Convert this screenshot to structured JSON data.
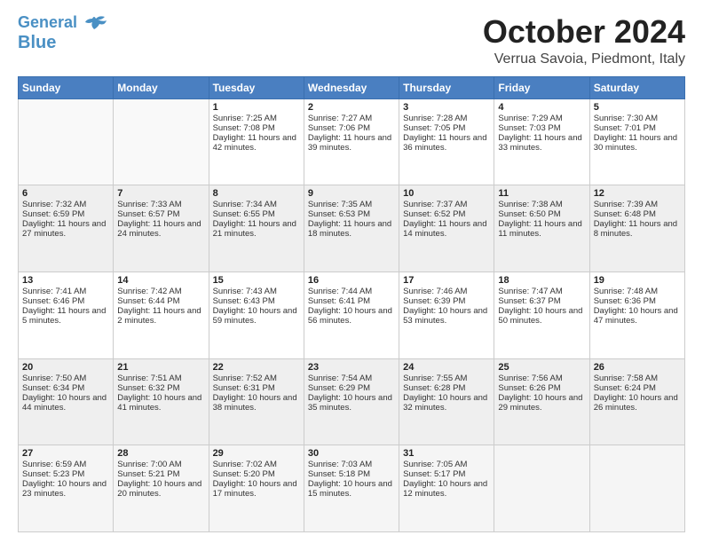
{
  "header": {
    "logo_line1": "General",
    "logo_line2": "Blue",
    "title": "October 2024",
    "subtitle": "Verrua Savoia, Piedmont, Italy"
  },
  "days_of_week": [
    "Sunday",
    "Monday",
    "Tuesday",
    "Wednesday",
    "Thursday",
    "Friday",
    "Saturday"
  ],
  "weeks": [
    [
      {
        "day": "",
        "info": ""
      },
      {
        "day": "",
        "info": ""
      },
      {
        "day": "1",
        "sunrise": "Sunrise: 7:25 AM",
        "sunset": "Sunset: 7:08 PM",
        "daylight": "Daylight: 11 hours and 42 minutes."
      },
      {
        "day": "2",
        "sunrise": "Sunrise: 7:27 AM",
        "sunset": "Sunset: 7:06 PM",
        "daylight": "Daylight: 11 hours and 39 minutes."
      },
      {
        "day": "3",
        "sunrise": "Sunrise: 7:28 AM",
        "sunset": "Sunset: 7:05 PM",
        "daylight": "Daylight: 11 hours and 36 minutes."
      },
      {
        "day": "4",
        "sunrise": "Sunrise: 7:29 AM",
        "sunset": "Sunset: 7:03 PM",
        "daylight": "Daylight: 11 hours and 33 minutes."
      },
      {
        "day": "5",
        "sunrise": "Sunrise: 7:30 AM",
        "sunset": "Sunset: 7:01 PM",
        "daylight": "Daylight: 11 hours and 30 minutes."
      }
    ],
    [
      {
        "day": "6",
        "sunrise": "Sunrise: 7:32 AM",
        "sunset": "Sunset: 6:59 PM",
        "daylight": "Daylight: 11 hours and 27 minutes."
      },
      {
        "day": "7",
        "sunrise": "Sunrise: 7:33 AM",
        "sunset": "Sunset: 6:57 PM",
        "daylight": "Daylight: 11 hours and 24 minutes."
      },
      {
        "day": "8",
        "sunrise": "Sunrise: 7:34 AM",
        "sunset": "Sunset: 6:55 PM",
        "daylight": "Daylight: 11 hours and 21 minutes."
      },
      {
        "day": "9",
        "sunrise": "Sunrise: 7:35 AM",
        "sunset": "Sunset: 6:53 PM",
        "daylight": "Daylight: 11 hours and 18 minutes."
      },
      {
        "day": "10",
        "sunrise": "Sunrise: 7:37 AM",
        "sunset": "Sunset: 6:52 PM",
        "daylight": "Daylight: 11 hours and 14 minutes."
      },
      {
        "day": "11",
        "sunrise": "Sunrise: 7:38 AM",
        "sunset": "Sunset: 6:50 PM",
        "daylight": "Daylight: 11 hours and 11 minutes."
      },
      {
        "day": "12",
        "sunrise": "Sunrise: 7:39 AM",
        "sunset": "Sunset: 6:48 PM",
        "daylight": "Daylight: 11 hours and 8 minutes."
      }
    ],
    [
      {
        "day": "13",
        "sunrise": "Sunrise: 7:41 AM",
        "sunset": "Sunset: 6:46 PM",
        "daylight": "Daylight: 11 hours and 5 minutes."
      },
      {
        "day": "14",
        "sunrise": "Sunrise: 7:42 AM",
        "sunset": "Sunset: 6:44 PM",
        "daylight": "Daylight: 11 hours and 2 minutes."
      },
      {
        "day": "15",
        "sunrise": "Sunrise: 7:43 AM",
        "sunset": "Sunset: 6:43 PM",
        "daylight": "Daylight: 10 hours and 59 minutes."
      },
      {
        "day": "16",
        "sunrise": "Sunrise: 7:44 AM",
        "sunset": "Sunset: 6:41 PM",
        "daylight": "Daylight: 10 hours and 56 minutes."
      },
      {
        "day": "17",
        "sunrise": "Sunrise: 7:46 AM",
        "sunset": "Sunset: 6:39 PM",
        "daylight": "Daylight: 10 hours and 53 minutes."
      },
      {
        "day": "18",
        "sunrise": "Sunrise: 7:47 AM",
        "sunset": "Sunset: 6:37 PM",
        "daylight": "Daylight: 10 hours and 50 minutes."
      },
      {
        "day": "19",
        "sunrise": "Sunrise: 7:48 AM",
        "sunset": "Sunset: 6:36 PM",
        "daylight": "Daylight: 10 hours and 47 minutes."
      }
    ],
    [
      {
        "day": "20",
        "sunrise": "Sunrise: 7:50 AM",
        "sunset": "Sunset: 6:34 PM",
        "daylight": "Daylight: 10 hours and 44 minutes."
      },
      {
        "day": "21",
        "sunrise": "Sunrise: 7:51 AM",
        "sunset": "Sunset: 6:32 PM",
        "daylight": "Daylight: 10 hours and 41 minutes."
      },
      {
        "day": "22",
        "sunrise": "Sunrise: 7:52 AM",
        "sunset": "Sunset: 6:31 PM",
        "daylight": "Daylight: 10 hours and 38 minutes."
      },
      {
        "day": "23",
        "sunrise": "Sunrise: 7:54 AM",
        "sunset": "Sunset: 6:29 PM",
        "daylight": "Daylight: 10 hours and 35 minutes."
      },
      {
        "day": "24",
        "sunrise": "Sunrise: 7:55 AM",
        "sunset": "Sunset: 6:28 PM",
        "daylight": "Daylight: 10 hours and 32 minutes."
      },
      {
        "day": "25",
        "sunrise": "Sunrise: 7:56 AM",
        "sunset": "Sunset: 6:26 PM",
        "daylight": "Daylight: 10 hours and 29 minutes."
      },
      {
        "day": "26",
        "sunrise": "Sunrise: 7:58 AM",
        "sunset": "Sunset: 6:24 PM",
        "daylight": "Daylight: 10 hours and 26 minutes."
      }
    ],
    [
      {
        "day": "27",
        "sunrise": "Sunrise: 6:59 AM",
        "sunset": "Sunset: 5:23 PM",
        "daylight": "Daylight: 10 hours and 23 minutes."
      },
      {
        "day": "28",
        "sunrise": "Sunrise: 7:00 AM",
        "sunset": "Sunset: 5:21 PM",
        "daylight": "Daylight: 10 hours and 20 minutes."
      },
      {
        "day": "29",
        "sunrise": "Sunrise: 7:02 AM",
        "sunset": "Sunset: 5:20 PM",
        "daylight": "Daylight: 10 hours and 17 minutes."
      },
      {
        "day": "30",
        "sunrise": "Sunrise: 7:03 AM",
        "sunset": "Sunset: 5:18 PM",
        "daylight": "Daylight: 10 hours and 15 minutes."
      },
      {
        "day": "31",
        "sunrise": "Sunrise: 7:05 AM",
        "sunset": "Sunset: 5:17 PM",
        "daylight": "Daylight: 10 hours and 12 minutes."
      },
      {
        "day": "",
        "info": ""
      },
      {
        "day": "",
        "info": ""
      }
    ]
  ]
}
